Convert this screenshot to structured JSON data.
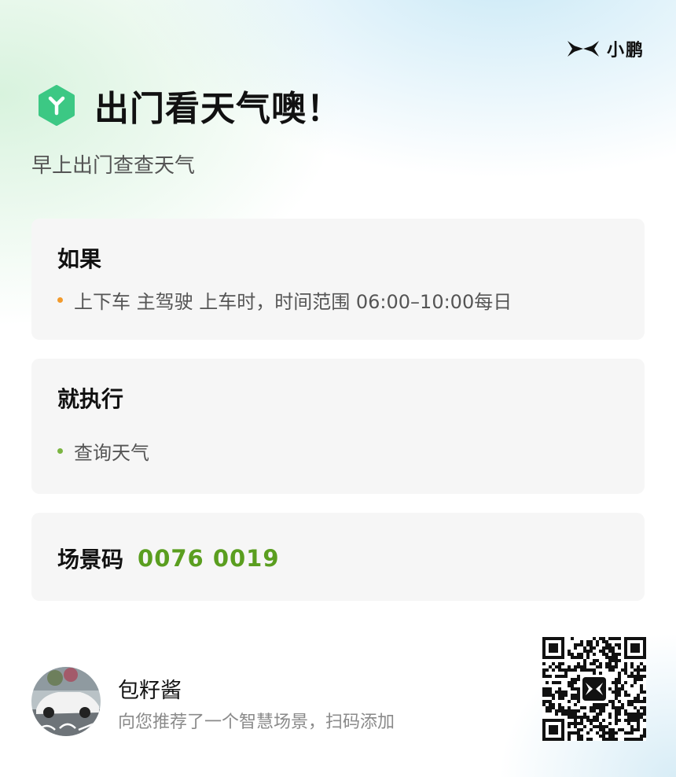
{
  "brand": {
    "name": "小鹏"
  },
  "header": {
    "title": "出门看天气噢！",
    "subtitle": "早上出门查查天气",
    "icon": "hexagon-y-icon",
    "icon_color": "#3cc884"
  },
  "condition_card": {
    "title": "如果",
    "items": [
      "上下车 主驾驶 上车时，时间范围 06:00–10:00每日"
    ],
    "bullet_color": "#f29a2c"
  },
  "action_card": {
    "title": "就执行",
    "items": [
      "查询天气"
    ],
    "bullet_color": "#7bb542"
  },
  "scene_code": {
    "label": "场景码",
    "value": "0076 0019",
    "value_color": "#5a9e1f"
  },
  "share": {
    "user_name": "包籽酱",
    "description": "向您推荐了一个智慧场景，扫码添加"
  },
  "qr": {
    "icon": "xpeng-logo-icon"
  }
}
